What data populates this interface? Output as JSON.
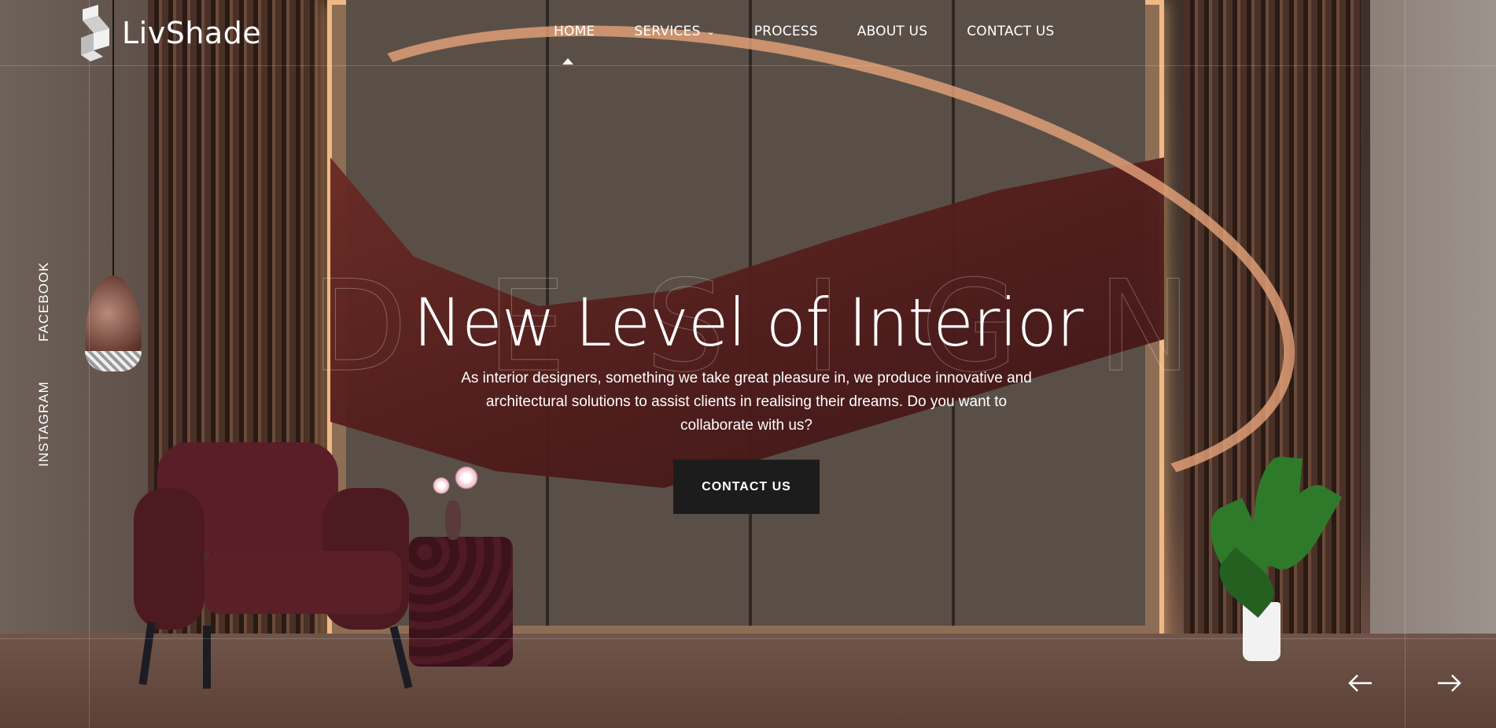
{
  "brand": {
    "name": "LivShade"
  },
  "nav": {
    "items": [
      {
        "label": "HOME",
        "active": true
      },
      {
        "label": "SERVICES",
        "has_dropdown": true
      },
      {
        "label": "PROCESS"
      },
      {
        "label": "ABOUT US"
      },
      {
        "label": "CONTACT US"
      }
    ]
  },
  "social": {
    "facebook": "FACEBOOK",
    "instagram": "INSTAGRAM"
  },
  "hero": {
    "background_word": [
      "D",
      "E",
      "S",
      "I",
      "G",
      "N"
    ],
    "title": "New Level of Interior",
    "description": "As interior designers, something we take great pleasure in, we produce innovative and architectural solutions to assist clients in realising their dreams. Do you want to collaborate with us?",
    "cta_label": "CONTACT US"
  },
  "slider": {
    "prev_icon": "arrow-left-icon",
    "next_icon": "arrow-right-icon"
  },
  "colors": {
    "cta_bg": "#1c1c1c",
    "text": "#ffffff"
  }
}
